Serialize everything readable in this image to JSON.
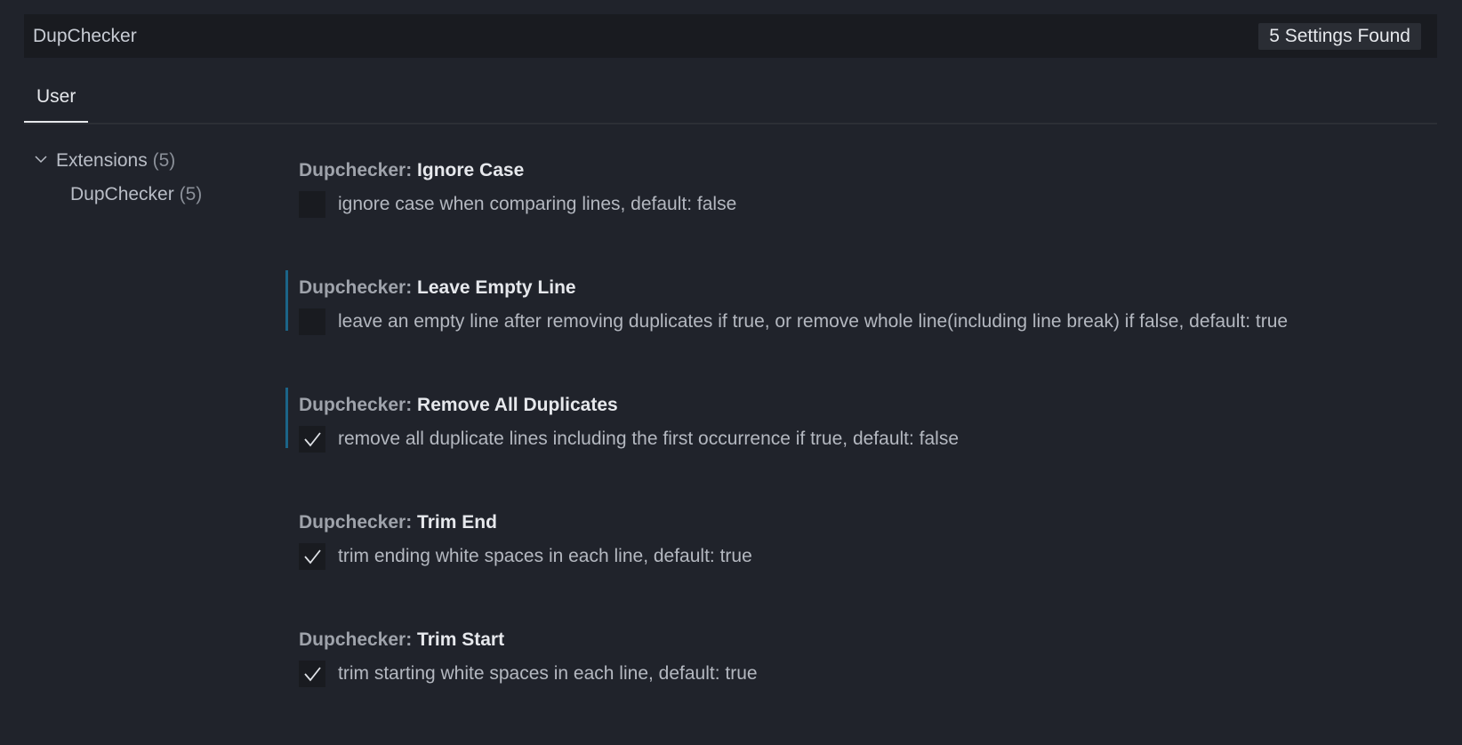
{
  "search": {
    "value": "DupChecker",
    "results_badge": "5 Settings Found"
  },
  "tabs": [
    {
      "label": "User"
    }
  ],
  "toc": {
    "group": {
      "label": "Extensions",
      "count": "(5)"
    },
    "items": [
      {
        "label": "DupChecker",
        "count": "(5)"
      }
    ]
  },
  "settings": [
    {
      "category": "Dupchecker: ",
      "name": "Ignore Case",
      "description": "ignore case when comparing lines, default: false",
      "checked": false,
      "modified": false
    },
    {
      "category": "Dupchecker: ",
      "name": "Leave Empty Line",
      "description": "leave an empty line after removing duplicates if true, or remove whole line(including line break) if false, default: true",
      "checked": false,
      "modified": true
    },
    {
      "category": "Dupchecker: ",
      "name": "Remove All Duplicates",
      "description": "remove all duplicate lines including the first occurrence if true, default: false",
      "checked": true,
      "modified": true
    },
    {
      "category": "Dupchecker: ",
      "name": "Trim End",
      "description": "trim ending white spaces in each line, default: true",
      "checked": true,
      "modified": false
    },
    {
      "category": "Dupchecker: ",
      "name": "Trim Start",
      "description": "trim starting white spaces in each line, default: true",
      "checked": true,
      "modified": false
    }
  ],
  "colors": {
    "background": "#20232b",
    "input_bg": "#191b20",
    "modified_indicator": "#1b6488",
    "text": "#c8ccd4"
  }
}
